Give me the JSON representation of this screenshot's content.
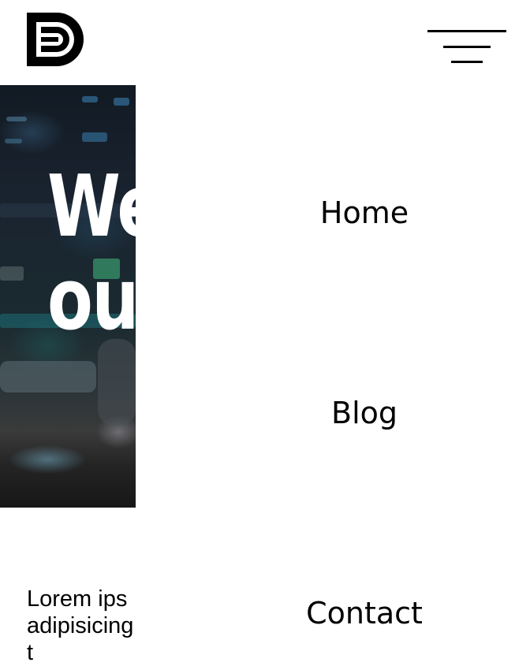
{
  "header": {
    "logo_icon": "db-monogram-logo",
    "menu_icon": "hamburger-menu-icon"
  },
  "hero": {
    "title_line1": "We",
    "title_line2": "ou"
  },
  "intro": {
    "line1": "Lorem ips",
    "line2": "adipisicing",
    "line3": "t"
  },
  "nav": {
    "items": [
      {
        "label": "Home"
      },
      {
        "label": "Blog"
      },
      {
        "label": "Contact"
      }
    ]
  }
}
